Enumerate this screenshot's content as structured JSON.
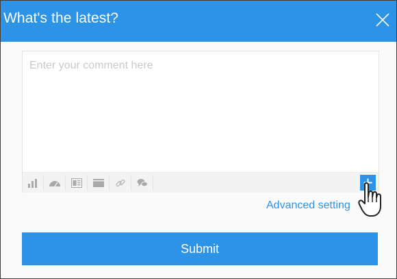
{
  "dialog": {
    "title": "What's the latest?",
    "close_icon": "close-icon"
  },
  "editor": {
    "placeholder": "Enter your comment here",
    "value": ""
  },
  "toolbar": {
    "tools": [
      {
        "name": "chart-icon"
      },
      {
        "name": "dashboard-icon"
      },
      {
        "name": "report-icon"
      },
      {
        "name": "card-icon"
      },
      {
        "name": "link-icon"
      },
      {
        "name": "discussion-icon"
      }
    ],
    "add_icon": "plus-icon"
  },
  "advanced": {
    "label": "Advanced setting"
  },
  "submit": {
    "label": "Submit"
  },
  "colors": {
    "accent": "#2d93e6",
    "placeholder": "#c9c9c9",
    "icon": "#a9a9a9"
  }
}
